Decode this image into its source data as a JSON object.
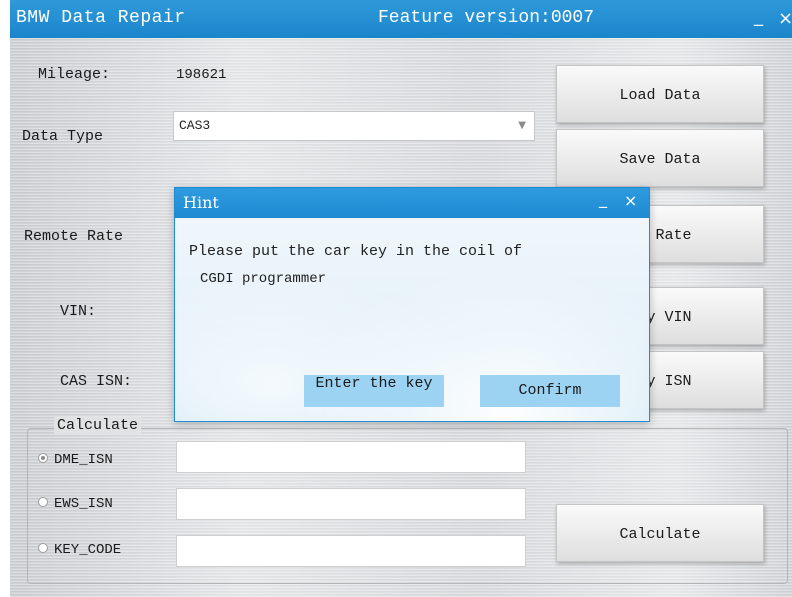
{
  "window": {
    "title": "BMW Data Repair",
    "feature_version": "Feature version:0007",
    "minimize_glyph": "_",
    "close_glyph": "×"
  },
  "fields": {
    "mileage_label": "Mileage:",
    "mileage_value": "198621",
    "data_type_label": "Data Type",
    "data_type_value": "CAS3",
    "remote_rate_label": "Remote Rate",
    "vin_label": "VIN:",
    "cas_isn_label": "CAS ISN:"
  },
  "buttons": {
    "load_data": "Load Data",
    "save_data": "Save Data",
    "modify_rate_visible": "fy Rate",
    "modify_vin_visible": "ify VIN",
    "modify_isn_visible": "ify ISN",
    "calculate": "Calculate"
  },
  "calculate_group": {
    "legend": "Calculate",
    "options": [
      {
        "label": "DME_ISN",
        "checked": true
      },
      {
        "label": "EWS_ISN",
        "checked": false
      },
      {
        "label": "KEY_CODE",
        "checked": false
      }
    ]
  },
  "dialog": {
    "title": "Hint",
    "minimize_glyph": "_",
    "close_glyph": "×",
    "message_line1": "Please put the car key in the coil of",
    "message_line2": "CGDI programmer",
    "enter_key_label": "Enter the key",
    "confirm_label": "Confirm"
  },
  "colors": {
    "title_bar": "#1f8fd4",
    "dialog_button": "#9dd3f2"
  }
}
